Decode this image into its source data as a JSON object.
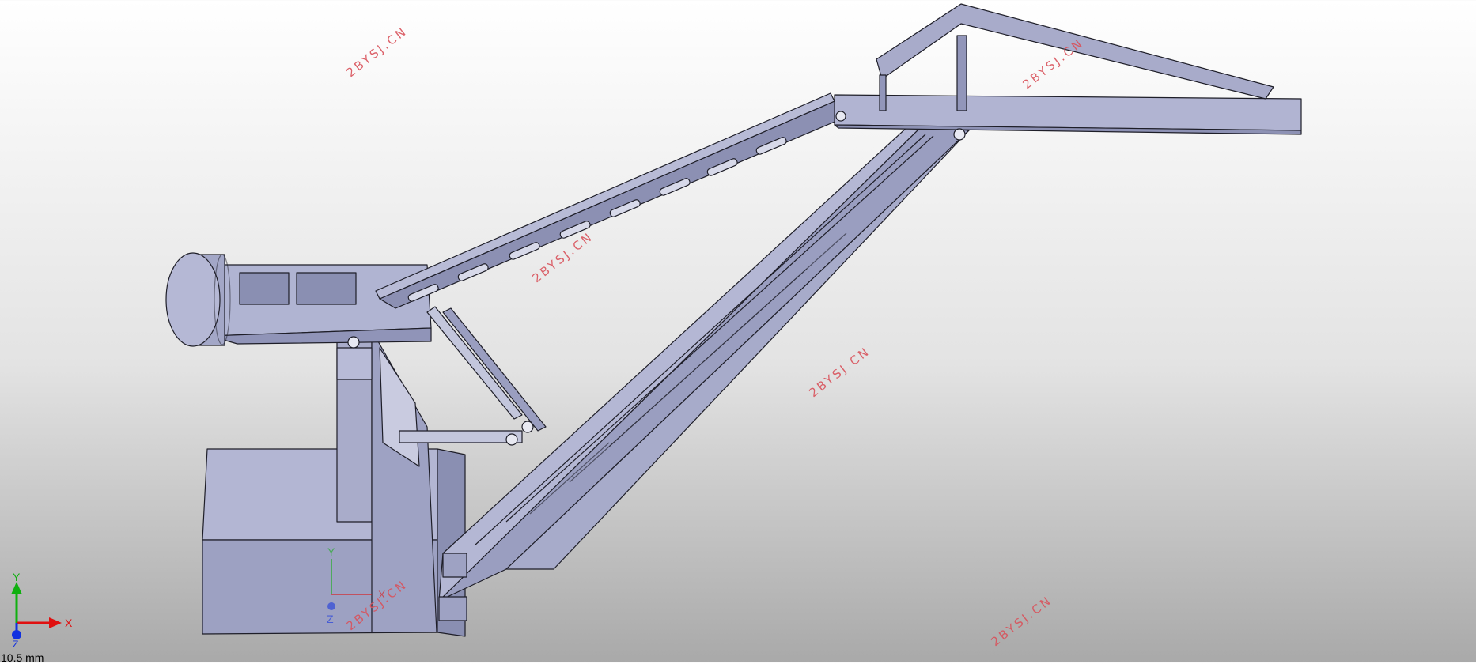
{
  "watermarks": [
    "2BYSJ.CN",
    "2BYSJ.CN",
    "2BYSJ.CN",
    "2BYSJ.CN",
    "2BYSJ.CN",
    "2BYSJ.CN"
  ],
  "triad": {
    "x_label": "X",
    "y_label": "Y",
    "z_label": "Z"
  },
  "origin_triad": {
    "x_label": "X",
    "y_label": "Y",
    "z_label": "Z"
  },
  "scale": {
    "readout": "10.5 mm"
  },
  "colors": {
    "part": "#a4a8c8",
    "part_dark": "#7f84a8",
    "part_light": "#c4c7dd",
    "edge": "#1e1e28",
    "axis_x": "#e01010",
    "axis_y": "#10b010",
    "axis_z": "#1030e0",
    "watermark": "#d9525b"
  }
}
